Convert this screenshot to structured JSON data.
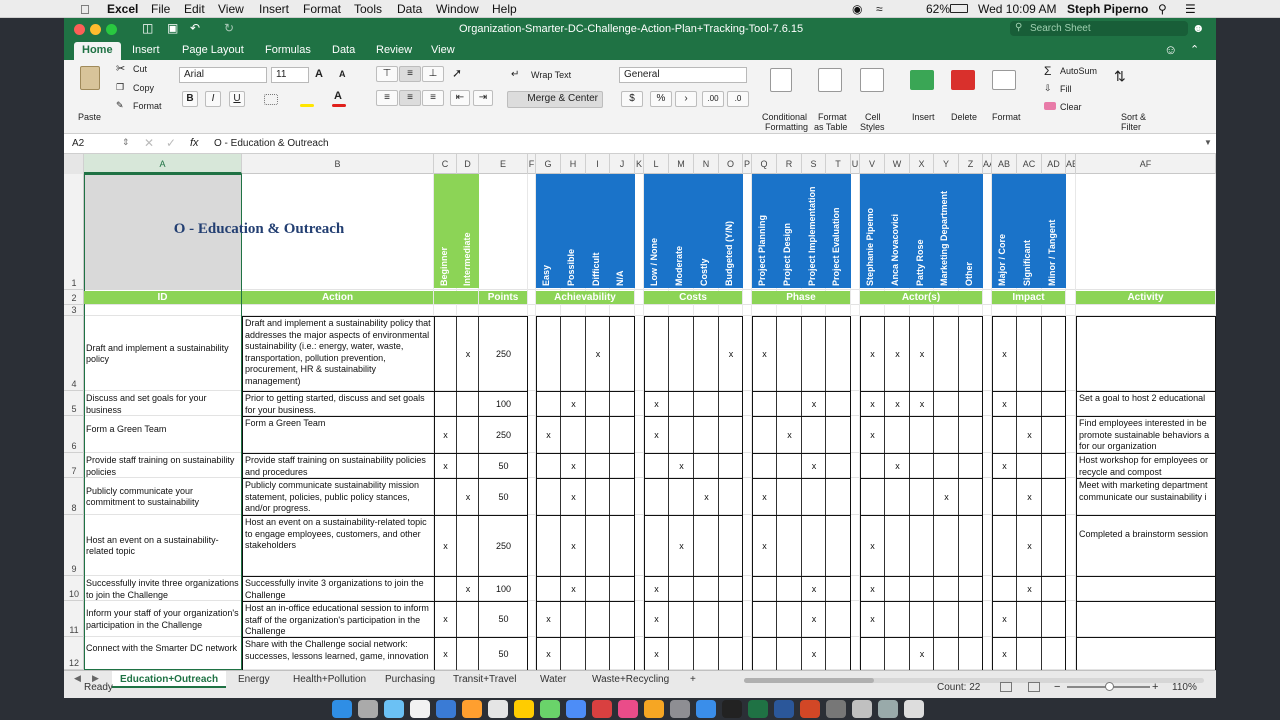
{
  "menubar": {
    "app": "Excel",
    "items": [
      "File",
      "Edit",
      "View",
      "Insert",
      "Format",
      "Tools",
      "Data",
      "Window",
      "Help"
    ],
    "battery": "62%",
    "clock": "Wed 10:09 AM",
    "user": "Steph Piperno"
  },
  "window": {
    "title": "Organization-Smarter-DC-Challenge-Action-Plan+Tracking-Tool-7.6.15",
    "search_placeholder": "Search Sheet"
  },
  "ribbon_tabs": [
    "Home",
    "Insert",
    "Page Layout",
    "Formulas",
    "Data",
    "Review",
    "View"
  ],
  "ribbon": {
    "paste": "Paste",
    "cut": "Cut",
    "copy": "Copy",
    "format": "Format",
    "font": "Arial",
    "size": "11",
    "wrap_text": "Wrap Text",
    "merge_center": "Merge & Center",
    "number_format": "General",
    "cond_format": [
      "Conditional",
      "Formatting"
    ],
    "format_table": [
      "Format",
      "as Table"
    ],
    "cell_styles": [
      "Cell",
      "Styles"
    ],
    "insert": "Insert",
    "delete": "Delete",
    "format_cells": "Format",
    "autosum": "AutoSum",
    "fill": "Fill",
    "clear": "Clear",
    "sort_filter": [
      "Sort &",
      "Filter"
    ],
    "bold": "B",
    "italic": "I",
    "underline": "U",
    "grow": "A",
    "shrink": "A",
    "currency": "$",
    "percent": "%",
    "comma": "›",
    "inc_dec": ".00",
    "dec_dec": ".0"
  },
  "formula_bar": {
    "cell_ref": "A2",
    "fx": "fx",
    "content": "O - Education & Outreach"
  },
  "columns": [
    "A",
    "B",
    "C",
    "D",
    "E",
    "F",
    "G",
    "H",
    "I",
    "J",
    "K",
    "L",
    "M",
    "N",
    "O",
    "P",
    "Q",
    "R",
    "S",
    "T",
    "U",
    "V",
    "W",
    "X",
    "Y",
    "Z",
    "AA",
    "AB",
    "AC",
    "AD",
    "AE",
    "AF"
  ],
  "row_numbers": [
    "1",
    "2",
    "3",
    "4",
    "5",
    "6",
    "7",
    "8",
    "9",
    "10",
    "11",
    "12"
  ],
  "sheet": {
    "title": "O - Education & Outreach",
    "id_header": "ID",
    "action_header": "Action",
    "level_headers": [
      "Beginner",
      "Intermediate"
    ],
    "points_header": "Points",
    "achievability_header": "Achievability",
    "achievability": [
      "Easy",
      "Possible",
      "Difficult",
      "N/A"
    ],
    "costs_header": "Costs",
    "costs": [
      "Low / None",
      "Moderate",
      "Costly",
      "Budgeted (Y/N)"
    ],
    "phase_header": "Phase",
    "phase": [
      "Project Planning",
      "Project Design",
      "Project Implementation",
      "Project Evaluation"
    ],
    "actors_header": "Actor(s)",
    "actors": [
      "Stephanie Pipemo",
      "Anca Novacovici",
      "Patty Rose",
      "Marketing Department",
      "Other"
    ],
    "impact_header": "Impact",
    "impact": [
      "Major / Core",
      "Significant",
      "Minor / Tangent"
    ],
    "activity_header": "Activity",
    "rows": [
      {
        "id": "Draft and implement a sustainability policy",
        "action": "Draft and implement a sustainability policy that addresses the major aspects of environmental sustainability (i.e.: energy, water, waste, transportation, pollution prevention, procurement, HR & sustainability management)",
        "beg": "",
        "int": "x",
        "points": "250",
        "ach": [
          "",
          "",
          "x",
          ""
        ],
        "cost": [
          "",
          "",
          "",
          "x"
        ],
        "phase": [
          "x",
          "",
          "",
          ""
        ],
        "act": [
          "x",
          "x",
          "x",
          "",
          ""
        ],
        "imp": [
          "x",
          "",
          ""
        ],
        "activity": ""
      },
      {
        "id": "Discuss and set goals for your business",
        "action": "Prior to getting started, discuss and set goals for your business.",
        "beg": "",
        "int": "",
        "points": "100",
        "ach": [
          "",
          "x",
          "",
          ""
        ],
        "cost": [
          "x",
          "",
          "",
          ""
        ],
        "phase": [
          "",
          "",
          "x",
          ""
        ],
        "act": [
          "x",
          "x",
          "x",
          "",
          ""
        ],
        "imp": [
          "x",
          "",
          ""
        ],
        "activity": "Set a goal to host 2 educational"
      },
      {
        "id": "Form a Green Team",
        "action": "Form a Green Team",
        "beg": "x",
        "int": "",
        "points": "250",
        "ach": [
          "x",
          "",
          "",
          ""
        ],
        "cost": [
          "x",
          "",
          "",
          ""
        ],
        "phase": [
          "",
          "x",
          "",
          ""
        ],
        "act": [
          "x",
          "",
          "",
          "",
          ""
        ],
        "imp": [
          "",
          "x",
          ""
        ],
        "activity": "Find employees interested in be promote sustainable behaviors a for our organization"
      },
      {
        "id": "Provide staff training on sustainability policies",
        "action": "Provide staff training on sustainability policies and procedures",
        "beg": "x",
        "int": "",
        "points": "50",
        "ach": [
          "",
          "x",
          "",
          ""
        ],
        "cost": [
          "",
          "x",
          "",
          ""
        ],
        "phase": [
          "",
          "",
          "x",
          ""
        ],
        "act": [
          "",
          "x",
          "",
          "",
          ""
        ],
        "imp": [
          "x",
          "",
          ""
        ],
        "activity": "Host workshop for employees or recycle and compost"
      },
      {
        "id": "Publicly communicate your commitment to sustainability",
        "action": "Publicly communicate sustainability mission statement, policies, public policy stances, and/or progress.",
        "beg": "",
        "int": "x",
        "points": "50",
        "ach": [
          "",
          "x",
          "",
          ""
        ],
        "cost": [
          "",
          "",
          "x",
          ""
        ],
        "phase": [
          "x",
          "",
          "",
          ""
        ],
        "act": [
          "",
          "",
          "",
          "x",
          ""
        ],
        "imp": [
          "",
          "x",
          ""
        ],
        "activity": "Meet with marketing department communicate our sustainability i"
      },
      {
        "id": "Host an event on a sustainability-related topic",
        "action": "Host an event on a sustainability-related topic to engage employees, customers, and other stakeholders",
        "beg": "x",
        "int": "",
        "points": "250",
        "ach": [
          "",
          "x",
          "",
          ""
        ],
        "cost": [
          "",
          "x",
          "",
          ""
        ],
        "phase": [
          "x",
          "",
          "",
          ""
        ],
        "act": [
          "x",
          "",
          "",
          "",
          ""
        ],
        "imp": [
          "",
          "x",
          ""
        ],
        "activity": "Completed a brainstorm session"
      },
      {
        "id": "Successfully invite three organizations to join the Challenge",
        "action": "Successfully invite 3 organizations to join the Challenge",
        "beg": "",
        "int": "x",
        "points": "100",
        "ach": [
          "",
          "x",
          "",
          ""
        ],
        "cost": [
          "x",
          "",
          "",
          ""
        ],
        "phase": [
          "",
          "",
          "x",
          ""
        ],
        "act": [
          "x",
          "",
          "",
          "",
          ""
        ],
        "imp": [
          "",
          "x",
          ""
        ],
        "activity": ""
      },
      {
        "id": "Inform your staff of your organization's participation in the Challenge",
        "action": "Host an in-office educational session to inform staff of the organization's participation in the Challenge",
        "beg": "x",
        "int": "",
        "points": "50",
        "ach": [
          "x",
          "",
          "",
          ""
        ],
        "cost": [
          "x",
          "",
          "",
          ""
        ],
        "phase": [
          "",
          "",
          "x",
          ""
        ],
        "act": [
          "x",
          "",
          "",
          "",
          ""
        ],
        "imp": [
          "x",
          "",
          ""
        ],
        "activity": ""
      },
      {
        "id": "Connect with the Smarter DC network",
        "action": "Share with the Challenge social network: successes, lessons learned, game, innovation",
        "beg": "x",
        "int": "",
        "points": "50",
        "ach": [
          "x",
          "",
          "",
          ""
        ],
        "cost": [
          "x",
          "",
          "",
          ""
        ],
        "phase": [
          "",
          "",
          "x",
          ""
        ],
        "act": [
          "",
          "",
          "x",
          "",
          ""
        ],
        "imp": [
          "x",
          "",
          ""
        ],
        "activity": ""
      }
    ]
  },
  "sheet_tabs": [
    "Education+Outreach",
    "Energy",
    "Health+Pollution",
    "Purchasing",
    "Transit+Travel",
    "Water",
    "Waste+Recycling",
    "+"
  ],
  "status": {
    "ready": "Ready",
    "count": "Count: 22",
    "zoom": "110%",
    "minus": "−",
    "plus": "+"
  },
  "colors": {
    "excel_green": "#1f7244",
    "header_green": "#8cd456",
    "header_blue": "#1a73c9",
    "selection": "#d9d9d9"
  }
}
